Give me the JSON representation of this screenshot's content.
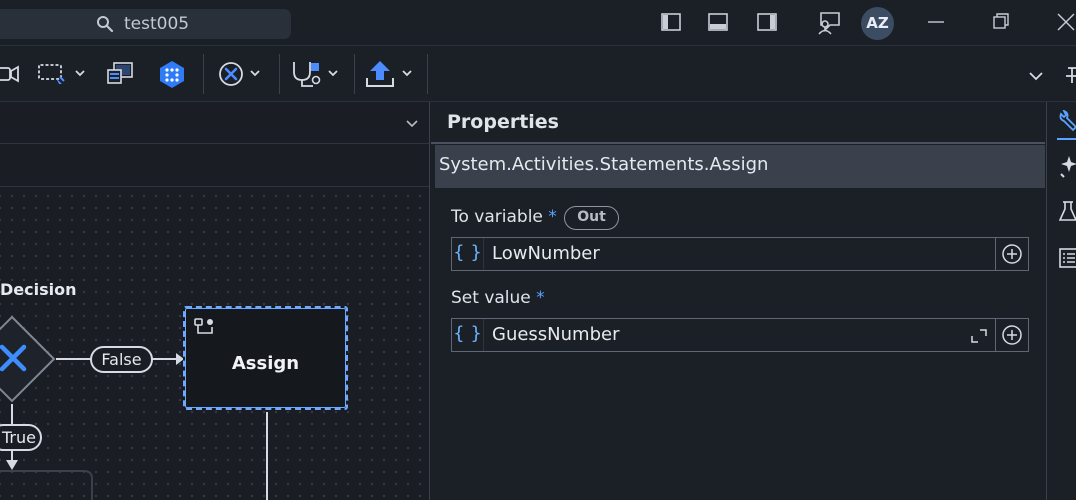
{
  "search": {
    "value": "test005"
  },
  "user": {
    "initials": "AZ"
  },
  "canvas": {
    "decision_label": "Decision",
    "false_label": "False",
    "true_label": "True",
    "assign_label": "Assign"
  },
  "properties": {
    "title": "Properties",
    "activity_type": "System.Activities.Statements.Assign",
    "to_variable": {
      "label": "To variable",
      "required": "*",
      "direction": "Out",
      "value": "LowNumber"
    },
    "set_value": {
      "label": "Set value",
      "required": "*",
      "value": "GuessNumber"
    }
  },
  "colors": {
    "accent": "#5aa3ff",
    "selection": "#6fa9ff",
    "background": "#1b1f26",
    "panel": "#3a414c"
  },
  "icons": {
    "titlebar": [
      "search-icon",
      "panel-left-icon",
      "panel-bottom-icon",
      "panel-right-icon",
      "feedback-icon",
      "minimize-icon",
      "restore-icon",
      "close-icon"
    ],
    "toolbar": [
      "record-icon",
      "screen-scraping-icon",
      "remote-icon",
      "packages-icon",
      "stop-icon",
      "debug-icon",
      "publish-icon",
      "chevron-down-icon",
      "pin-icon"
    ],
    "rail": [
      "properties-wrench-icon",
      "extensions-icon",
      "test-icon",
      "outline-list-icon"
    ]
  }
}
